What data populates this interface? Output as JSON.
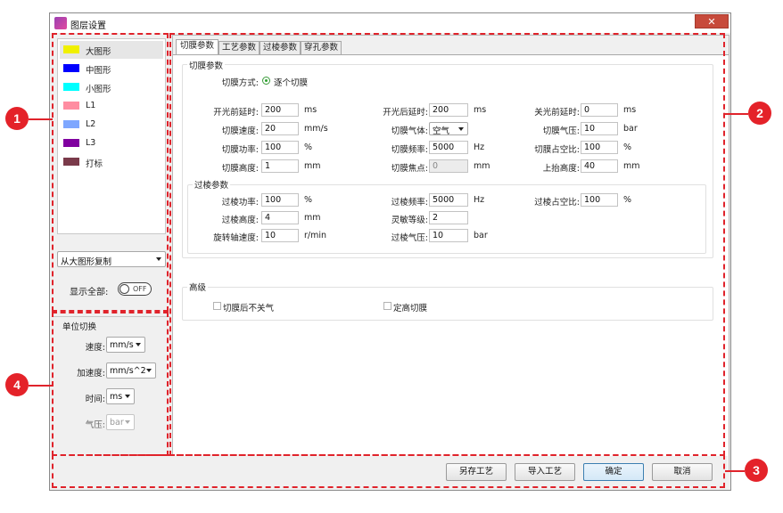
{
  "window": {
    "title": "图层设置",
    "close_glyph": "✕"
  },
  "layers": [
    {
      "label": "大图形",
      "color": "#f0f000"
    },
    {
      "label": "中图形",
      "color": "#0000ff"
    },
    {
      "label": "小图形",
      "color": "#00ffff"
    },
    {
      "label": "L1",
      "color": "#ff8da1"
    },
    {
      "label": "L2",
      "color": "#7ea7ff"
    },
    {
      "label": "L3",
      "color": "#8000a0"
    },
    {
      "label": "打标",
      "color": "#7a3a4a"
    }
  ],
  "copy_from": {
    "value": "从大图形复制"
  },
  "show_all": {
    "label": "显示全部:",
    "state": "OFF"
  },
  "unit_switch": {
    "title": "单位切换",
    "speed": {
      "label": "速度:",
      "value": "mm/s"
    },
    "accel": {
      "label": "加速度:",
      "value": "mm/s^2"
    },
    "time": {
      "label": "时间:",
      "value": "ms"
    },
    "pressure": {
      "label": "气压:",
      "value": "bar"
    }
  },
  "tabs": [
    "切膜参数",
    "工艺参数",
    "过棱参数",
    "穿孔参数"
  ],
  "cut": {
    "group_title": "切膜参数",
    "mode": {
      "label": "切膜方式:",
      "value": "逐个切膜"
    },
    "rows": [
      [
        {
          "label": "开光前延时:",
          "value": "200",
          "unit": "ms"
        },
        {
          "label": "开光后延时:",
          "value": "200",
          "unit": "ms"
        },
        {
          "label": "关光前延时:",
          "value": "0",
          "unit": "ms"
        }
      ],
      [
        {
          "label": "切膜速度:",
          "value": "20",
          "unit": "mm/s"
        },
        {
          "label": "切膜气体:",
          "value": "空气",
          "unit": ""
        },
        {
          "label": "切膜气压:",
          "value": "10",
          "unit": "bar"
        }
      ],
      [
        {
          "label": "切膜功率:",
          "value": "100",
          "unit": "%"
        },
        {
          "label": "切膜频率:",
          "value": "5000",
          "unit": "Hz"
        },
        {
          "label": "切膜占空比:",
          "value": "100",
          "unit": "%"
        }
      ],
      [
        {
          "label": "切膜高度:",
          "value": "1",
          "unit": "mm"
        },
        {
          "label": "切膜焦点:",
          "value": "0",
          "unit": "mm"
        },
        {
          "label": "上抬高度:",
          "value": "40",
          "unit": "mm"
        }
      ]
    ]
  },
  "edge": {
    "group_title": "过棱参数",
    "rows": [
      [
        {
          "label": "过棱功率:",
          "value": "100",
          "unit": "%"
        },
        {
          "label": "过棱频率:",
          "value": "5000",
          "unit": "Hz"
        },
        {
          "label": "过棱占空比:",
          "value": "100",
          "unit": "%"
        }
      ],
      [
        {
          "label": "过棱高度:",
          "value": "4",
          "unit": "mm"
        },
        {
          "label": "灵敏等级:",
          "value": "2",
          "unit": ""
        }
      ],
      [
        {
          "label": "旋转轴速度:",
          "value": "10",
          "unit": "r/min"
        },
        {
          "label": "过棱气压:",
          "value": "10",
          "unit": "bar"
        }
      ]
    ]
  },
  "advanced": {
    "group_title": "高级",
    "no_gas_after_cut": "切膜后不关气",
    "fixed_height_cut": "定高切膜"
  },
  "buttons": {
    "save_as": "另存工艺",
    "import": "导入工艺",
    "ok": "确定",
    "cancel": "取消"
  },
  "annotations": [
    "1",
    "2",
    "3",
    "4"
  ],
  "colors": {
    "annotation": "#e42229",
    "window_bg": "#f0f0f0"
  }
}
